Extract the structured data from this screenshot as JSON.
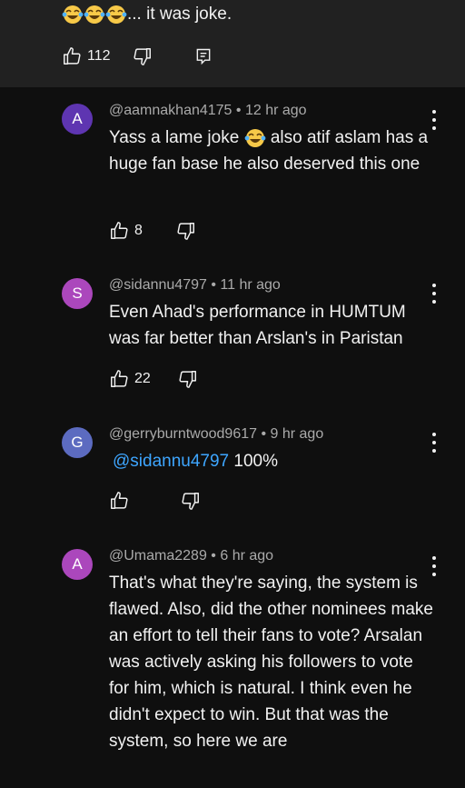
{
  "parent_comment": {
    "text": "... it was joke.",
    "like_count": "112",
    "icons": [
      "joy-emoji",
      "like-icon",
      "dislike-icon",
      "reply-icon"
    ]
  },
  "replies": [
    {
      "avatar_letter": "A",
      "avatar_color": "#5e35b1",
      "handle": "@aamnakhan4175",
      "time": "12 hr ago",
      "text_before_emoji": "Yass a lame joke",
      "text_after_emoji": "also atif aslam has a huge fan base he also deserved this one",
      "like_count": "8"
    },
    {
      "avatar_letter": "S",
      "avatar_color": "#ab47bc",
      "handle": "@sidannu4797",
      "time": "11 hr ago",
      "text": "Even Ahad's performance in HUMTUM was far better than Arslan's in Paristan",
      "like_count": "22"
    },
    {
      "avatar_letter": "G",
      "avatar_color": "#5c6bc0",
      "handle": "@gerryburntwood9617",
      "time": "9 hr ago",
      "mention": "@sidannu4797",
      "text": "100%",
      "like_count": ""
    },
    {
      "avatar_letter": "A",
      "avatar_color": "#ab47bc",
      "handle": "@Umama2289",
      "time": "6 hr ago",
      "text": "That's what they're saying, the system is flawed. Also, did the other nominees make an effort to tell their fans to vote? Arsalan was actively asking his followers to vote for him, which is natural. I think even he didn't expect to win. But that was the system, so here we are"
    }
  ],
  "separator": " • ",
  "colors": {
    "background": "#0f0f0f",
    "parent_background": "#212121",
    "mention": "#3ea6ff",
    "meta": "#aaaaaa"
  }
}
